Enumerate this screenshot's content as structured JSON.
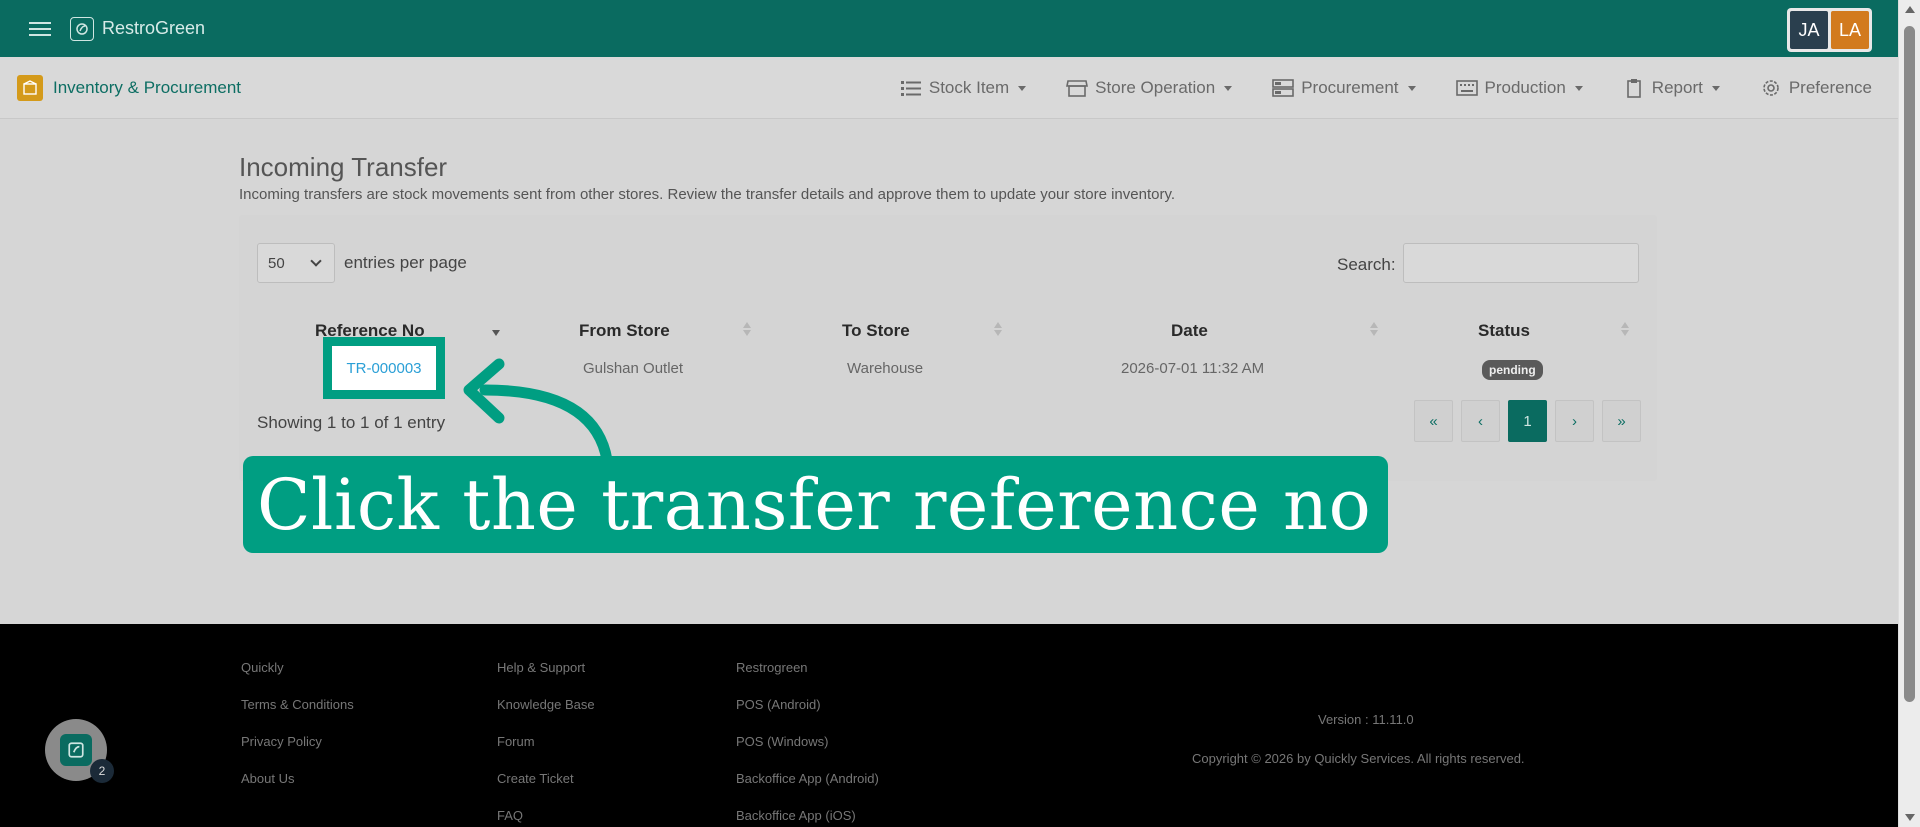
{
  "topbar": {
    "brand": "RestroGreen",
    "avatars": [
      "JA",
      "LA"
    ]
  },
  "navbar": {
    "module_title": "Inventory & Procurement",
    "menu": [
      "Stock Item",
      "Store Operation",
      "Procurement",
      "Production",
      "Report",
      "Preference"
    ]
  },
  "page": {
    "title": "Incoming Transfer",
    "subtitle": "Incoming transfers are stock movements sent from other stores. Review the transfer details and approve them to update your store inventory."
  },
  "table_controls": {
    "page_length": "50",
    "page_length_label": "entries per page",
    "search_label": "Search:",
    "search_value": ""
  },
  "table": {
    "columns": [
      "Reference No",
      "From Store",
      "To Store",
      "Date",
      "Status"
    ],
    "rows": [
      {
        "reference": "TR-000003",
        "from_store": "Gulshan Outlet",
        "to_store": "Warehouse",
        "date": "2026-07-01 11:32 AM",
        "status": "pending"
      }
    ]
  },
  "pagination": {
    "info": "Showing 1 to 1 of 1 entry",
    "first": "«",
    "prev": "‹",
    "current": "1",
    "next": "›",
    "last": "»"
  },
  "callout": {
    "text": "Click the transfer reference no"
  },
  "footer": {
    "col1": [
      "Quickly",
      "Terms & Conditions",
      "Privacy Policy",
      "About Us"
    ],
    "col2": [
      "Help & Support",
      "Knowledge Base",
      "Forum",
      "Create Ticket",
      "FAQ"
    ],
    "col3": [
      "Restrogreen",
      "POS (Android)",
      "POS (Windows)",
      "Backoffice App (Android)",
      "Backoffice App (iOS)"
    ],
    "version": "Version : 11.11.0",
    "copyright": "Copyright © 2026 by Quickly Services. All rights reserved.",
    "chat_count": "2"
  },
  "colors": {
    "brand_green": "#0a6b60",
    "accent_green": "#009e82",
    "module_orange": "#d49a1a"
  }
}
